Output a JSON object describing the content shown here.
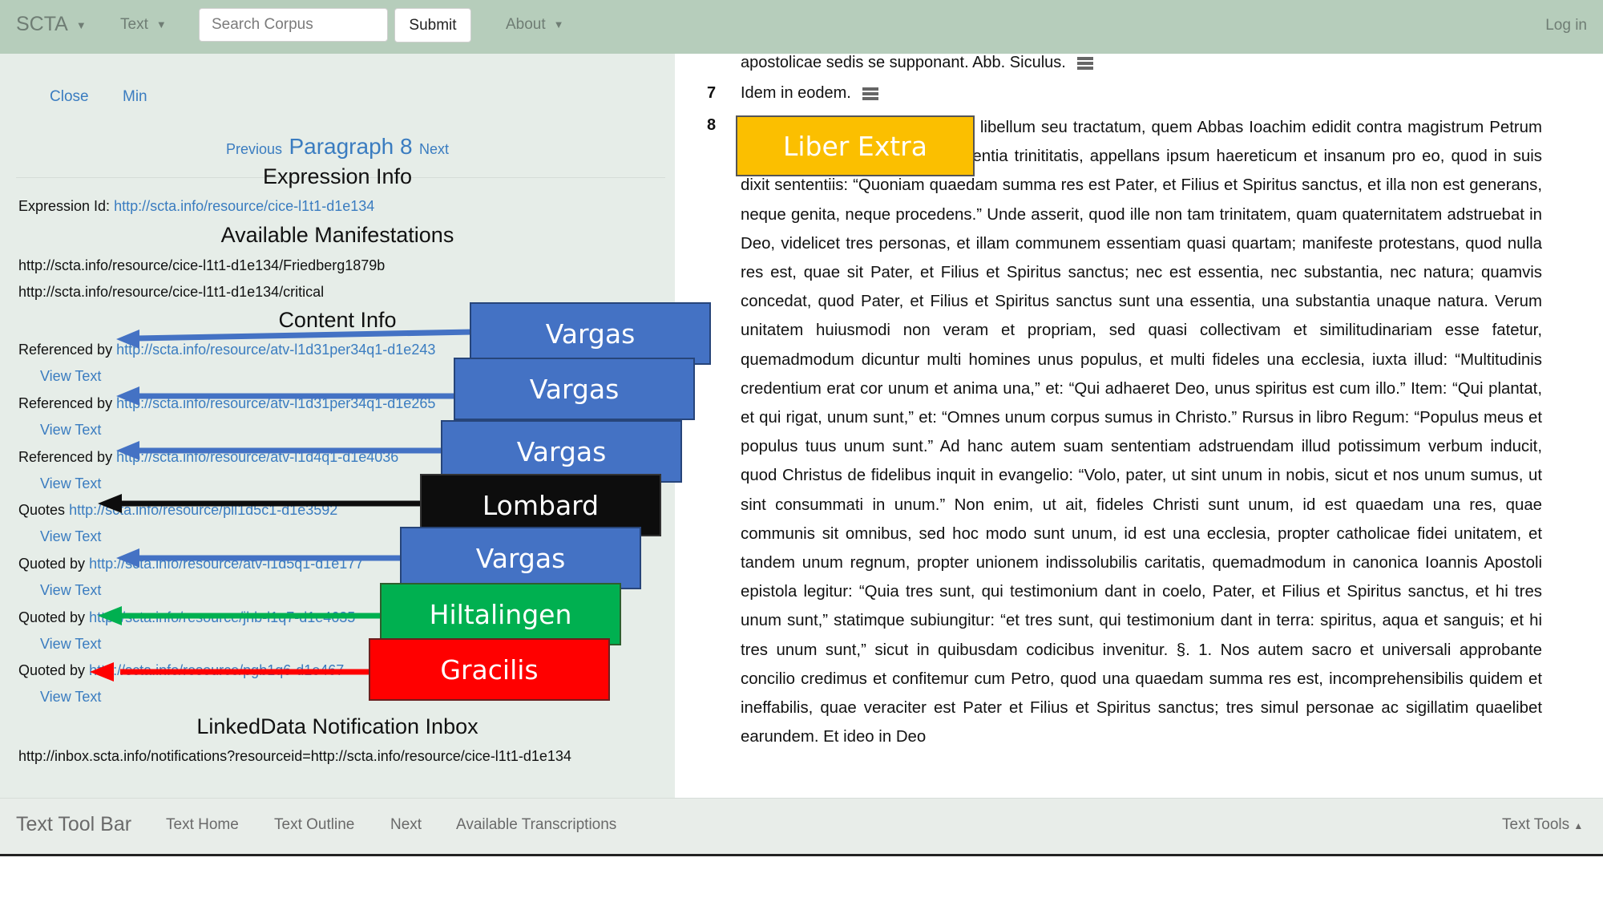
{
  "navbar": {
    "brand": "SCTA",
    "text_menu": "Text",
    "search_placeholder": "Search Corpus",
    "submit_label": "Submit",
    "about_menu": "About",
    "login_label": "Log in"
  },
  "panel": {
    "close_label": "Close",
    "min_label": "Min",
    "previous_label": "Previous",
    "paragraph_title": "Paragraph 8",
    "next_label": "Next",
    "expression_heading": "Expression Info",
    "expression_id_label": "Expression Id:",
    "expression_id_url": "http://scta.info/resource/cice-l1t1-d1e134",
    "manifestations_heading": "Available Manifestations",
    "manifestations": [
      "http://scta.info/resource/cice-l1t1-d1e134/Friedberg1879b",
      "http://scta.info/resource/cice-l1t1-d1e134/critical"
    ],
    "content_heading": "Content Info",
    "content_items": [
      {
        "label": "Referenced by",
        "url": "http://scta.info/resource/atv-l1d31per34q1-d1e243",
        "view_text": "View Text"
      },
      {
        "label": "Referenced by",
        "url": "http://scta.info/resource/atv-l1d31per34q1-d1e265",
        "view_text": "View Text"
      },
      {
        "label": "Referenced by",
        "url": "http://scta.info/resource/atv-l1d4q1-d1e4036",
        "view_text": "View Text"
      },
      {
        "label": "Quotes",
        "url": "http://scta.info/resource/pll1d5c1-d1e3592",
        "view_text": "View Text"
      },
      {
        "label": "Quoted by",
        "url": "http://scta.info/resource/atv-l1d5q1-d1e177",
        "view_text": "View Text"
      },
      {
        "label": "Quoted by",
        "url": "http://scta.info/resource/jhb-l1q7-d1e4635",
        "view_text": "View Text"
      },
      {
        "label": "Quoted by",
        "url": "http://scta.info/resource/pgb1q6-d1e467",
        "view_text": "View Text"
      }
    ],
    "inbox_heading": "LinkedData Notification Inbox",
    "inbox_url": "http://inbox.scta.info/notifications?resourceid=http://scta.info/resource/cice-l1t1-d1e134"
  },
  "text": {
    "line_top": "apostolicae sedis se supponant. Abb. Siculus.",
    "para7_number": "7",
    "para7_text": "Idem in eodem.",
    "para8_number": "8",
    "para8_text": "Damnamus ergo et reprobamus libellum seu tractatum, quem Abbas Ioachim edidit contra magistrum Petrum Lombardum de unitate seu essentia trinititatis, appellans ipsum haereticum et insanum pro eo, quod in suis dixit sententiis: “Quoniam quaedam summa res est Pater, et Filius et Spiritus sanctus, et illa non est generans, neque genita, neque procedens.” Unde asserit, quod ille non tam trinitatem, quam quaternitatem adstruebat in Deo, videlicet tres personas, et illam communem essentiam quasi quartam; manifeste protestans, quod nulla res est, quae sit Pater, et Filius et Spiritus sanctus; nec est essentia, nec substantia, nec natura; quamvis concedat, quod Pater, et Filius et Spiritus sanctus sunt una essentia, una substantia unaque natura. Verum unitatem huiusmodi non veram et propriam, sed quasi collectivam et similitudinariam esse fatetur, quemadmodum dicuntur multi homines unus populus, et multi fideles una ecclesia, iuxta illud: “Multitudinis credentium erat cor unum et anima una,” et: “Qui adhaeret Deo, unus spiritus est cum illo.” Item: “Qui plantat, et qui rigat, unum sunt,” et: “Omnes unum corpus sumus in Christo.” Rursus in libro Regum: “Populus meus et populus tuus unum sunt.” Ad hanc autem suam sententiam adstruendam illud potissimum verbum inducit, quod Christus de fidelibus inquit in evangelio: “Volo, pater, ut sint unum in nobis, sicut et nos unum sumus, ut sint consummati in unum.” Non enim, ut ait, fideles Christi sunt unum, id est quaedam una res, quae communis sit omnibus, sed hoc modo sunt unum, id est una ecclesia, propter catholicae fidei unitatem, et tandem unum regnum, propter unionem indissolubilis caritatis, quemadmodum in canonica Ioannis Apostoli epistola legitur: “Quia tres sunt, qui testimonium dant in coelo, Pater, et Filius et Spiritus sanctus, et hi tres unum sunt,” statimque subiungitur: “et tres sunt, qui testimonium dant in terra: spiritus, aqua et sanguis; et hi tres unum sunt,” sicut in quibusdam codicibus invenitur. §. 1. Nos autem sacro et universali approbante concilio credimus et confitemur cum Petro, quod una quaedam summa res est, incomprehensibilis quidem et ineffabilis, quae veraciter est Pater et Filius et Spiritus sanctus; tres simul personae ac sigillatim quaelibet earundem. Et ideo in Deo"
  },
  "toolbar": {
    "title": "Text Tool Bar",
    "home": "Text Home",
    "outline": "Text Outline",
    "next": "Next",
    "transcriptions": "Available Transcriptions",
    "tools": "Text Tools"
  },
  "annotations": {
    "liber_extra": {
      "text": "Liber Extra",
      "color": "#fbbf00"
    },
    "vargas": {
      "color": "#4472c4"
    },
    "lombard": {
      "color": "#0d0d0d"
    },
    "hiltalingen": {
      "color": "#00b050"
    },
    "gracilis": {
      "color": "#ff0000"
    },
    "labels": [
      "Vargas",
      "Vargas",
      "Vargas",
      "Lombard",
      "Vargas",
      "Hiltalingen",
      "Gracilis"
    ]
  }
}
